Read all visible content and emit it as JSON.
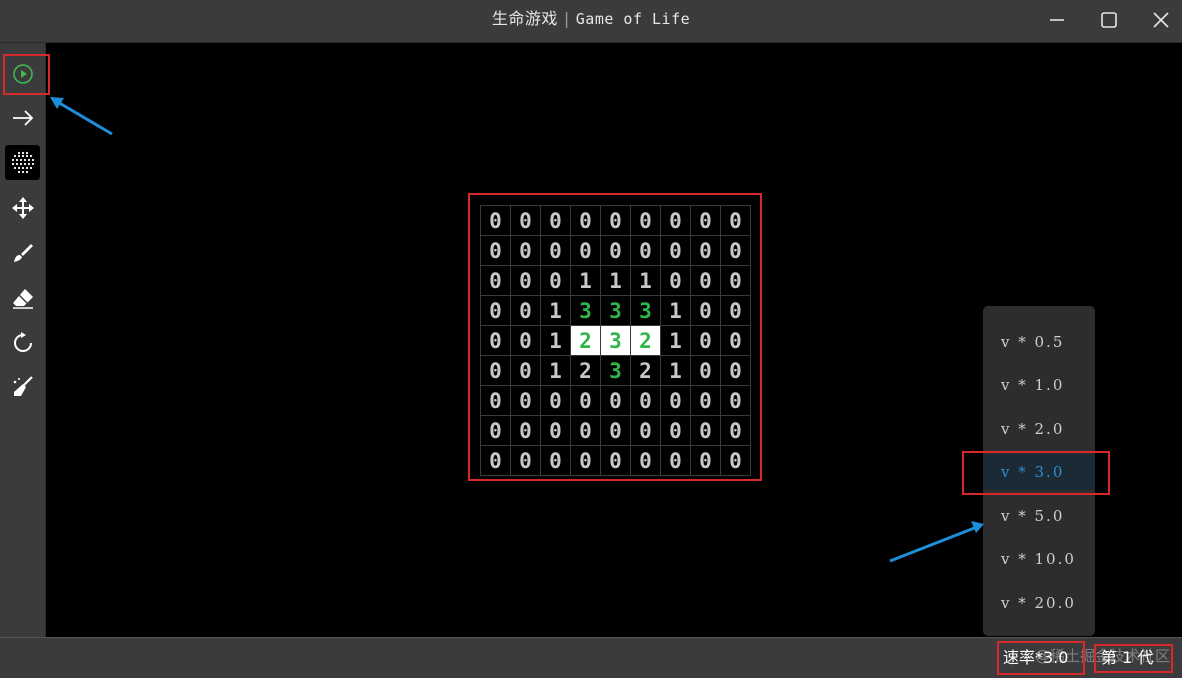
{
  "window": {
    "title_cn": "生命游戏",
    "title_sep": "|",
    "title_en": "Game of Life",
    "controls": [
      "minimize-icon",
      "maximize-icon",
      "close-icon"
    ]
  },
  "toolbar": {
    "tools": [
      {
        "name": "play-icon",
        "color": "#3fb950"
      },
      {
        "name": "step-arrow-icon"
      },
      {
        "name": "grid-icon",
        "selected": true
      },
      {
        "name": "move-icon"
      },
      {
        "name": "brush-icon"
      },
      {
        "name": "eraser-icon"
      },
      {
        "name": "reset-icon"
      },
      {
        "name": "clean-icon"
      }
    ]
  },
  "grid": {
    "cells": [
      [
        "0",
        "0",
        "0",
        "0",
        "0",
        "0",
        "0",
        "0",
        "0"
      ],
      [
        "0",
        "0",
        "0",
        "0",
        "0",
        "0",
        "0",
        "0",
        "0"
      ],
      [
        "0",
        "0",
        "0",
        "1",
        "1",
        "1",
        "0",
        "0",
        "0"
      ],
      [
        "0",
        "0",
        "1",
        "3",
        "3",
        "3",
        "1",
        "0",
        "0"
      ],
      [
        "0",
        "0",
        "1",
        "2",
        "3",
        "2",
        "1",
        "0",
        "0"
      ],
      [
        "0",
        "0",
        "1",
        "2",
        "3",
        "2",
        "1",
        "0",
        "0"
      ],
      [
        "0",
        "0",
        "0",
        "0",
        "0",
        "0",
        "0",
        "0",
        "0"
      ],
      [
        "0",
        "0",
        "0",
        "0",
        "0",
        "0",
        "0",
        "0",
        "0"
      ],
      [
        "0",
        "0",
        "0",
        "0",
        "0",
        "0",
        "0",
        "0",
        "0"
      ]
    ],
    "alive": [
      [
        4,
        3
      ],
      [
        4,
        4
      ],
      [
        4,
        5
      ]
    ],
    "green": [
      [
        3,
        3
      ],
      [
        3,
        4
      ],
      [
        3,
        5
      ],
      [
        4,
        3
      ],
      [
        4,
        4
      ],
      [
        4,
        5
      ],
      [
        5,
        4
      ]
    ]
  },
  "speed_menu": {
    "items": [
      "v * 0.5",
      "v * 1.0",
      "v * 2.0",
      "v * 3.0",
      "v * 5.0",
      "v * 10.0",
      "v * 20.0"
    ],
    "selected_index": 3
  },
  "status": {
    "speed_label": "速率*3.0",
    "generation_label": "第 1 代",
    "watermark": "@稀土掘金技术社区"
  },
  "colors": {
    "accent_blue": "#2a8fd6",
    "highlight_red": "#d62a2a",
    "alive_green": "#2fb54a"
  }
}
